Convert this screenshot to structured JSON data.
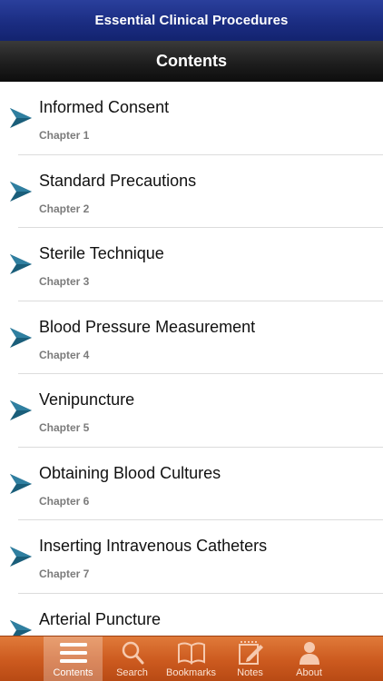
{
  "app": {
    "title": "Essential Clinical Procedures"
  },
  "nav": {
    "title": "Contents"
  },
  "chapters": [
    {
      "title": "Informed Consent",
      "subtitle": "Chapter 1"
    },
    {
      "title": "Standard Precautions",
      "subtitle": "Chapter 2"
    },
    {
      "title": "Sterile Technique",
      "subtitle": "Chapter 3"
    },
    {
      "title": "Blood Pressure Measurement",
      "subtitle": "Chapter 4"
    },
    {
      "title": "Venipuncture",
      "subtitle": "Chapter 5"
    },
    {
      "title": "Obtaining Blood Cultures",
      "subtitle": "Chapter 6"
    },
    {
      "title": "Inserting Intravenous Catheters",
      "subtitle": "Chapter 7"
    },
    {
      "title": "Arterial Puncture",
      "subtitle": ""
    }
  ],
  "tabs": [
    {
      "label": "Contents",
      "icon": "list-icon",
      "active": true
    },
    {
      "label": "Search",
      "icon": "magnifier-icon",
      "active": false
    },
    {
      "label": "Bookmarks",
      "icon": "open-book-icon",
      "active": false
    },
    {
      "label": "Notes",
      "icon": "notepad-pencil-icon",
      "active": false
    },
    {
      "label": "About",
      "icon": "person-icon",
      "active": false
    }
  ],
  "colors": {
    "title_bar": "#1b2d82",
    "nav_bar": "#1e1e1e",
    "tab_bar": "#cc5a1f",
    "arrow": "#1a5e7a"
  }
}
